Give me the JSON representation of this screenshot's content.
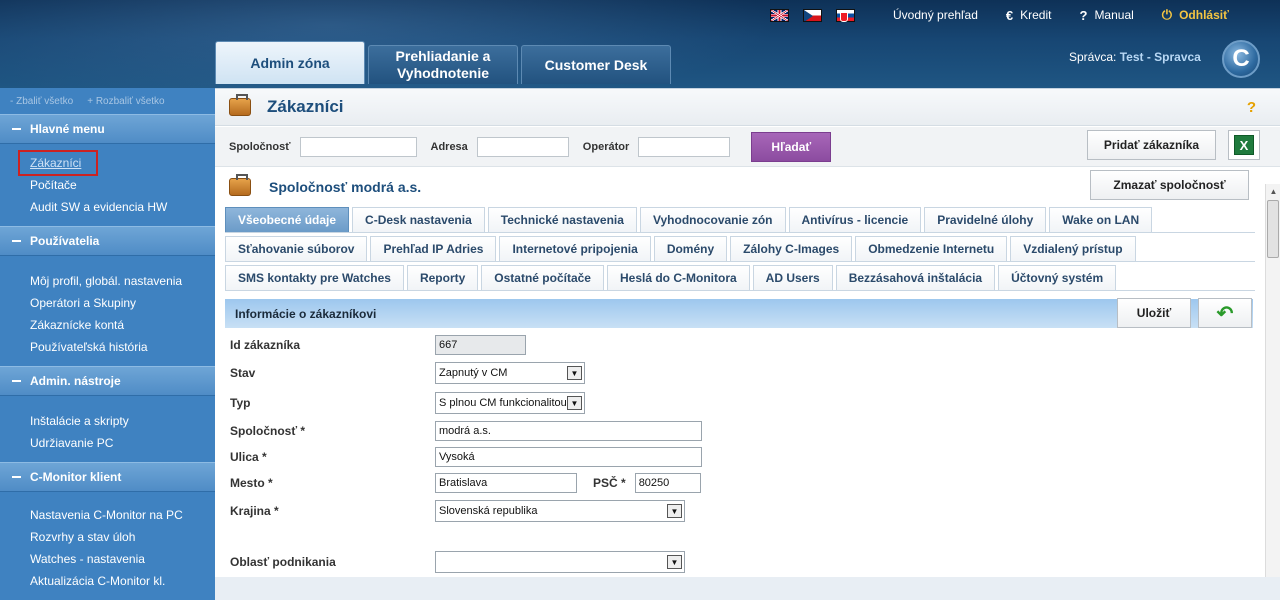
{
  "header": {
    "links": {
      "home": "Úvodný prehľad",
      "credit": "Kredit",
      "manual": "Manual",
      "logout": "Odhlásiť"
    },
    "icons": {
      "credit": "€",
      "manual": "?",
      "logout": "⏻"
    },
    "tabs": [
      {
        "label": "Admin zóna"
      },
      {
        "label1": "Prehliadanie a",
        "label2": "Vyhodnotenie"
      },
      {
        "label": "Customer Desk"
      }
    ],
    "admin_label": "Správca:",
    "admin_user": "Test - Spravca",
    "logo": "C"
  },
  "sidebar": {
    "collapse_all": "- Zbaliť všetko",
    "expand_all": "+ Rozbaliť všetko",
    "sections": [
      {
        "title": "Hlavné menu",
        "items": [
          "Zákazníci",
          "Počítače",
          "Audit SW a evidencia HW"
        ]
      },
      {
        "title": "Používatelia",
        "items": [
          "Môj profil, globál. nastavenia",
          "Operátori a Skupiny",
          "Zákaznícke kontá",
          "Používateľská história"
        ]
      },
      {
        "title": "Admin. nástroje",
        "items": [
          "Inštalácie a skripty",
          "Udržiavanie PC"
        ]
      },
      {
        "title": "C-Monitor klient",
        "items": [
          "Nastavenia C-Monitor na PC",
          "Rozvrhy a stav úloh",
          "Watches - nastavenia",
          "Aktualizácia C-Monitor kl."
        ]
      }
    ]
  },
  "page": {
    "title": "Zákazníci",
    "help": "?",
    "search": {
      "company_label": "Spoločnosť",
      "address_label": "Adresa",
      "operator_label": "Operátor",
      "search_button": "Hľadať",
      "add_button": "Pridať zákazníka",
      "excel": "X"
    },
    "company_name": "Spoločnosť modrá a.s.",
    "delete_button": "Zmazať spoločnosť",
    "subtabs": [
      [
        "Všeobecné údaje",
        "C-Desk nastavenia",
        "Technické nastavenia",
        "Vyhodnocovanie zón",
        "Antivírus - licencie",
        "Pravidelné úlohy",
        "Wake on LAN"
      ],
      [
        "Sťahovanie súborov",
        "Prehľad IP Adries",
        "Internetové pripojenia",
        "Domény",
        "Zálohy C-Images",
        "Obmedzenie Internetu",
        "Vzdialený prístup"
      ],
      [
        "SMS kontakty pre Watches",
        "Reporty",
        "Ostatné počítače",
        "Heslá do C-Monitora",
        "AD Users",
        "Bezzásahová inštalácia",
        "Účtovný systém"
      ]
    ],
    "section_title": "Informácie o zákazníkovi",
    "save_button": "Uložiť",
    "back_icon": "↶",
    "form": {
      "id_label": "Id zákazníka",
      "id_value": "667",
      "status_label": "Stav",
      "status_value": "Zapnutý v CM",
      "type_label": "Typ",
      "type_value": "S plnou CM funkcionalitou",
      "company_label": "Spoločnosť *",
      "company_value": "modrá a.s.",
      "street_label": "Ulica *",
      "street_value": "Vysoká",
      "city_label": "Mesto *",
      "city_value": "Bratislava",
      "zip_label": "PSČ *",
      "zip_value": "80250",
      "country_label": "Krajina *",
      "country_value": "Slovenská republika",
      "business_label": "Oblasť podnikania",
      "business_value": ""
    }
  },
  "colors": {
    "accent": "#1d4e7c",
    "search_button": "#8c4ca0",
    "sidebar": "#3f82c1",
    "active_subtab": "#6b9bc8"
  }
}
